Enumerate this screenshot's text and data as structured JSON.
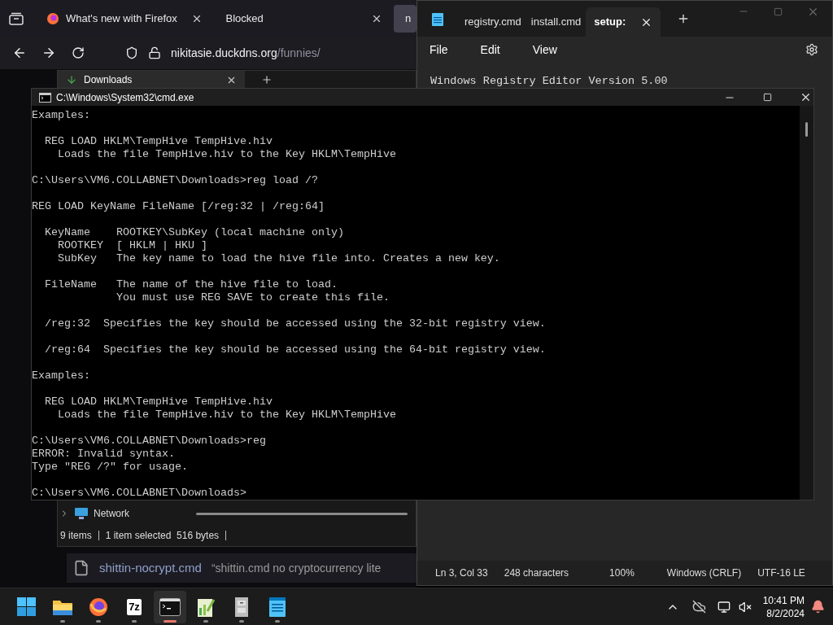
{
  "browser": {
    "tabs": [
      {
        "label": "What's new with Firefox",
        "favicon": true,
        "selected": false
      },
      {
        "label": "Blocked",
        "favicon": false,
        "selected": false
      },
      {
        "label": "n",
        "favicon": false,
        "selected": true
      }
    ],
    "url_host": "nikitasie.duckdns.org",
    "url_path": "/funnies/",
    "download": {
      "file": "shittin-nocrypt.cmd",
      "description": "“shittin.cmd no cryptocurrency lite"
    }
  },
  "explorer": {
    "tab": "Downloads",
    "nav_item": "Network",
    "status": [
      "9 items",
      "1 item selected  516 bytes"
    ]
  },
  "notepad": {
    "tabs": [
      {
        "label": "registry.cmd",
        "selected": false
      },
      {
        "label": "install.cmd",
        "selected": false
      },
      {
        "label": "setup:",
        "selected": true
      }
    ],
    "menu": [
      "File",
      "Edit",
      "View"
    ],
    "content": "Windows Registry Editor Version 5.00",
    "status": [
      "Ln 3, Col 33",
      "248 characters",
      "100%",
      "Windows (CRLF)",
      "UTF-16 LE"
    ]
  },
  "console": {
    "title": "C:\\Windows\\System32\\cmd.exe",
    "blocks": [
      [
        "Examples:"
      ],
      [
        "  REG LOAD HKLM\\TempHive TempHive.hiv",
        "    Loads the file TempHive.hiv to the Key HKLM\\TempHive"
      ],
      [
        "C:\\Users\\VM6.COLLABNET\\Downloads>reg load /?"
      ],
      [
        "REG LOAD KeyName FileName [/reg:32 | /reg:64]"
      ],
      [
        "  KeyName    ROOTKEY\\SubKey (local machine only)",
        "    ROOTKEY  [ HKLM | HKU ]",
        "    SubKey   The key name to load the hive file into. Creates a new key."
      ],
      [
        "  FileName   The name of the hive file to load.",
        "             You must use REG SAVE to create this file."
      ],
      [
        "  /reg:32  Specifies the key should be accessed using the 32-bit registry view."
      ],
      [
        "  /reg:64  Specifies the key should be accessed using the 64-bit registry view."
      ],
      [
        "Examples:"
      ],
      [
        "  REG LOAD HKLM\\TempHive TempHive.hiv",
        "    Loads the file TempHive.hiv to the Key HKLM\\TempHive"
      ],
      [
        "C:\\Users\\VM6.COLLABNET\\Downloads>reg",
        "ERROR: Invalid syntax.",
        "Type \"REG /?\" for usage."
      ],
      [
        "C:\\Users\\VM6.COLLABNET\\Downloads>"
      ]
    ]
  },
  "taskbar": {
    "apps": [
      {
        "kind": "folder",
        "active": false
      },
      {
        "kind": "firefox",
        "active": false
      },
      {
        "kind": "sevenzip",
        "label": "7z",
        "active": false
      },
      {
        "kind": "terminal",
        "active": true
      },
      {
        "kind": "editor",
        "active": false
      },
      {
        "kind": "cabinet",
        "active": false
      },
      {
        "kind": "notepad",
        "active": false
      }
    ],
    "time": "10:41 PM",
    "date": "8/2/2024"
  }
}
